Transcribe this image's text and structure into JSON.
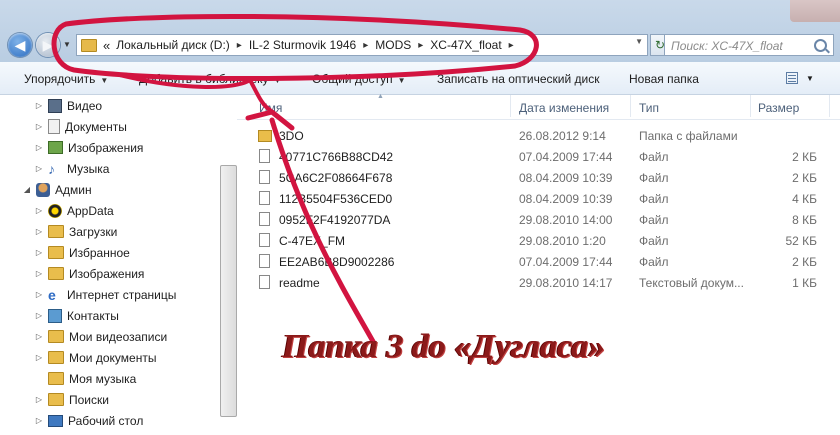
{
  "address": {
    "history_prefix": "«",
    "breadcrumbs": [
      "Локальный диск (D:)",
      "IL-2 Sturmovik 1946",
      "MODS",
      "XC-47X_float"
    ],
    "separator": "▸",
    "search_placeholder": "Поиск: XC-47X_float"
  },
  "toolbar": {
    "organize": "Упорядочить",
    "add_to_library": "Добавить в библиотеку",
    "share": "Общий доступ",
    "burn": "Записать на оптический диск",
    "new_folder": "Новая папка"
  },
  "nav": {
    "items": [
      {
        "label": "Видео",
        "icon": "video-icon"
      },
      {
        "label": "Документы",
        "icon": "documents-icon"
      },
      {
        "label": "Изображения",
        "icon": "pictures-icon"
      },
      {
        "label": "Музыка",
        "icon": "music-icon"
      },
      {
        "label": "Админ",
        "icon": "user-icon"
      },
      {
        "label": "AppData",
        "icon": "appdata-icon"
      },
      {
        "label": "Загрузки",
        "icon": "folder-icon"
      },
      {
        "label": "Избранное",
        "icon": "folder-icon"
      },
      {
        "label": "Изображения",
        "icon": "folder-icon"
      },
      {
        "label": "Интернет страницы",
        "icon": "ie-icon"
      },
      {
        "label": "Контакты",
        "icon": "contacts-icon"
      },
      {
        "label": "Мои видеозаписи",
        "icon": "folder-icon"
      },
      {
        "label": "Мои документы",
        "icon": "folder-icon"
      },
      {
        "label": "Моя музыка",
        "icon": "folder-icon"
      },
      {
        "label": "Поиски",
        "icon": "search-icon"
      },
      {
        "label": "Рабочий стол",
        "icon": "desktop-icon"
      }
    ]
  },
  "columns": {
    "name": "Имя",
    "date": "Дата изменения",
    "type": "Тип",
    "size": "Размер"
  },
  "files": [
    {
      "name": "3DO",
      "date": "26.08.2012 9:14",
      "type": "Папка с файлами",
      "size": "",
      "kind": "folder"
    },
    {
      "name": "40771C766B88CD42",
      "date": "07.04.2009 17:44",
      "type": "Файл",
      "size": "2 КБ",
      "kind": "file"
    },
    {
      "name": "5CA6C2F08664F678",
      "date": "08.04.2009 10:39",
      "type": "Файл",
      "size": "2 КБ",
      "kind": "file"
    },
    {
      "name": "112B5504F536CED0",
      "date": "08.04.2009 10:39",
      "type": "Файл",
      "size": "4 КБ",
      "kind": "file"
    },
    {
      "name": "0952F2F4192077DA",
      "date": "29.08.2010 14:00",
      "type": "Файл",
      "size": "8 КБ",
      "kind": "file"
    },
    {
      "name": "C-47EX_FM",
      "date": "29.08.2010 1:20",
      "type": "Файл",
      "size": "52 КБ",
      "kind": "file"
    },
    {
      "name": "EE2AB6B8D9002286",
      "date": "07.04.2009 17:44",
      "type": "Файл",
      "size": "2 КБ",
      "kind": "file"
    },
    {
      "name": "readme",
      "date": "29.08.2010 14:17",
      "type": "Текстовый докум...",
      "size": "1 КБ",
      "kind": "file"
    }
  ],
  "annotation": {
    "text": "Папка 3 do «Дугласа»",
    "color": "#c4123a"
  }
}
